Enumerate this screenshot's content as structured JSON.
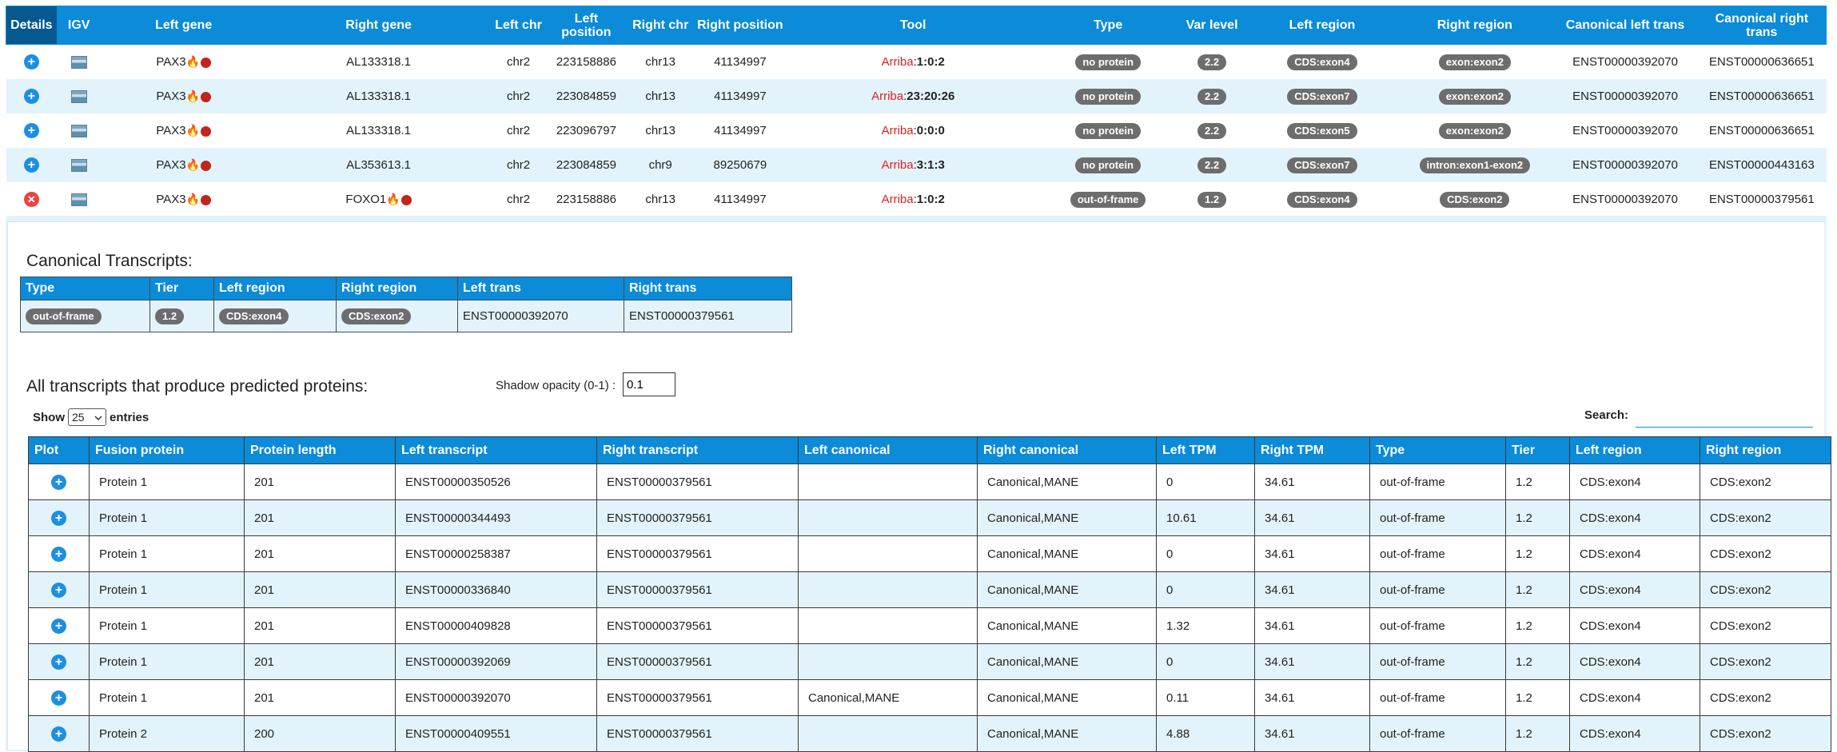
{
  "fusion_table": {
    "headers": [
      "Details",
      "IGV",
      "Left gene",
      "Right gene",
      "Left chr",
      "Left position",
      "Right chr",
      "Right position",
      "Tool",
      "Type",
      "Var level",
      "Left region",
      "Right region",
      "Canonical left trans",
      "Canonical right trans"
    ],
    "rows": [
      {
        "details": "plus",
        "left_gene": "PAX3",
        "right_gene": "AL133318.1",
        "right_gene_icons": false,
        "left_chr": "chr2",
        "left_pos": "223158886",
        "right_chr": "chr13",
        "right_pos": "41134997",
        "tool_name": "Arriba",
        "tool_sep": ":",
        "tool_val": "1:0:2",
        "type": "no protein",
        "var_level": "2.2",
        "left_region": "CDS:exon4",
        "right_region": "exon:exon2",
        "canon_left": "ENST00000392070",
        "canon_right": "ENST00000636651"
      },
      {
        "details": "plus",
        "left_gene": "PAX3",
        "right_gene": "AL133318.1",
        "right_gene_icons": false,
        "left_chr": "chr2",
        "left_pos": "223084859",
        "right_chr": "chr13",
        "right_pos": "41134997",
        "tool_name": "Arriba",
        "tool_sep": ":",
        "tool_val": "23:20:26",
        "type": "no protein",
        "var_level": "2.2",
        "left_region": "CDS:exon7",
        "right_region": "exon:exon2",
        "canon_left": "ENST00000392070",
        "canon_right": "ENST00000636651"
      },
      {
        "details": "plus",
        "left_gene": "PAX3",
        "right_gene": "AL133318.1",
        "right_gene_icons": false,
        "left_chr": "chr2",
        "left_pos": "223096797",
        "right_chr": "chr13",
        "right_pos": "41134997",
        "tool_name": "Arriba",
        "tool_sep": ":",
        "tool_val": "0:0:0",
        "type": "no protein",
        "var_level": "2.2",
        "left_region": "CDS:exon5",
        "right_region": "exon:exon2",
        "canon_left": "ENST00000392070",
        "canon_right": "ENST00000636651"
      },
      {
        "details": "plus",
        "left_gene": "PAX3",
        "right_gene": "AL353613.1",
        "right_gene_icons": false,
        "left_chr": "chr2",
        "left_pos": "223084859",
        "right_chr": "chr9",
        "right_pos": "89250679",
        "tool_name": "Arriba",
        "tool_sep": ":",
        "tool_val": "3:1:3",
        "type": "no protein",
        "var_level": "2.2",
        "left_region": "CDS:exon7",
        "right_region": "intron:exon1-exon2",
        "canon_left": "ENST00000392070",
        "canon_right": "ENST00000443163"
      },
      {
        "details": "close",
        "left_gene": "PAX3",
        "right_gene": "FOXO1",
        "right_gene_icons": true,
        "left_chr": "chr2",
        "left_pos": "223158886",
        "right_chr": "chr13",
        "right_pos": "41134997",
        "tool_name": "Arriba",
        "tool_sep": ":",
        "tool_val": "1:0:2",
        "type": "out-of-frame",
        "var_level": "1.2",
        "left_region": "CDS:exon4",
        "right_region": "CDS:exon2",
        "canon_left": "ENST00000392070",
        "canon_right": "ENST00000379561"
      }
    ]
  },
  "canonical": {
    "title": "Canonical Transcripts:",
    "headers": [
      "Type",
      "Tier",
      "Left region",
      "Right region",
      "Left trans",
      "Right trans"
    ],
    "row": {
      "type": "out-of-frame",
      "tier": "1.2",
      "left_region": "CDS:exon4",
      "right_region": "CDS:exon2",
      "left_trans": "ENST00000392070",
      "right_trans": "ENST00000379561"
    }
  },
  "proteins": {
    "title": "All transcripts that produce predicted proteins:",
    "opacity_label": "Shadow opacity (0-1) :",
    "opacity_value": "0.1",
    "show_label": "Show",
    "show_value": "25",
    "entries_label": "entries",
    "search_label": "Search:",
    "headers": [
      "Plot",
      "Fusion protein",
      "Protein length",
      "Left transcript",
      "Right transcript",
      "Left canonical",
      "Right canonical",
      "Left TPM",
      "Right TPM",
      "Type",
      "Tier",
      "Left region",
      "Right region"
    ],
    "rows": [
      [
        "Protein 1",
        "201",
        "ENST00000350526",
        "ENST00000379561",
        "",
        "Canonical,MANE",
        "0",
        "34.61",
        "out-of-frame",
        "1.2",
        "CDS:exon4",
        "CDS:exon2"
      ],
      [
        "Protein 1",
        "201",
        "ENST00000344493",
        "ENST00000379561",
        "",
        "Canonical,MANE",
        "10.61",
        "34.61",
        "out-of-frame",
        "1.2",
        "CDS:exon4",
        "CDS:exon2"
      ],
      [
        "Protein 1",
        "201",
        "ENST00000258387",
        "ENST00000379561",
        "",
        "Canonical,MANE",
        "0",
        "34.61",
        "out-of-frame",
        "1.2",
        "CDS:exon4",
        "CDS:exon2"
      ],
      [
        "Protein 1",
        "201",
        "ENST00000336840",
        "ENST00000379561",
        "",
        "Canonical,MANE",
        "0",
        "34.61",
        "out-of-frame",
        "1.2",
        "CDS:exon4",
        "CDS:exon2"
      ],
      [
        "Protein 1",
        "201",
        "ENST00000409828",
        "ENST00000379561",
        "",
        "Canonical,MANE",
        "1.32",
        "34.61",
        "out-of-frame",
        "1.2",
        "CDS:exon4",
        "CDS:exon2"
      ],
      [
        "Protein 1",
        "201",
        "ENST00000392069",
        "ENST00000379561",
        "",
        "Canonical,MANE",
        "0",
        "34.61",
        "out-of-frame",
        "1.2",
        "CDS:exon4",
        "CDS:exon2"
      ],
      [
        "Protein 1",
        "201",
        "ENST00000392070",
        "ENST00000379561",
        "Canonical,MANE",
        "Canonical,MANE",
        "0.11",
        "34.61",
        "out-of-frame",
        "1.2",
        "CDS:exon4",
        "CDS:exon2"
      ],
      [
        "Protein 2",
        "200",
        "ENST00000409551",
        "ENST00000379561",
        "",
        "Canonical,MANE",
        "4.88",
        "34.61",
        "out-of-frame",
        "1.2",
        "CDS:exon4",
        "CDS:exon2"
      ]
    ]
  },
  "colors": {
    "header_blue": "#0b8bd8",
    "row_alt": "#e3f3fb",
    "pill_gray": "#6d6d6d",
    "plus_blue": "#1c8fe3",
    "close_red": "#ea4343",
    "tool_red": "#e02020"
  }
}
